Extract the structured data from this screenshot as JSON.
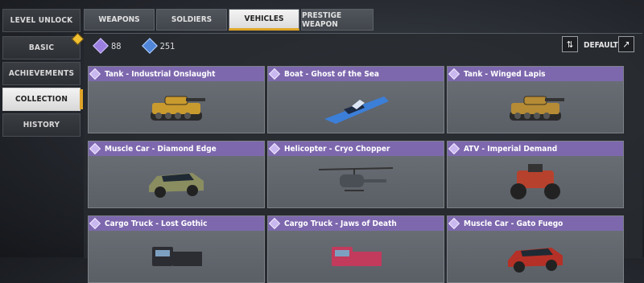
{
  "sidebar": {
    "items": [
      {
        "label": "LEVEL UNLOCK"
      },
      {
        "label": "BASIC"
      },
      {
        "label": "ACHIEVEMENTS"
      },
      {
        "label": "COLLECTION"
      },
      {
        "label": "HISTORY"
      }
    ],
    "active": "COLLECTION"
  },
  "tabs": [
    {
      "label": "WEAPONS"
    },
    {
      "label": "SOLDIERS"
    },
    {
      "label": "VEHICLES"
    },
    {
      "label": "PRESTIGE WEAPON"
    }
  ],
  "active_tab": "VEHICLES",
  "currency": [
    {
      "value": "88",
      "icon": "purple-diamond-icon",
      "color": "#9b7fe0"
    },
    {
      "value": "251",
      "icon": "blue-diamond-icon",
      "color": "#4f86d8"
    }
  ],
  "toolbar": {
    "sort_label": "DEFAULT"
  },
  "vehicles": [
    {
      "name": "Tank - Industrial Onslaught",
      "icon": "tank-icon",
      "color": "#c99a2e"
    },
    {
      "name": "Boat - Ghost of the Sea",
      "icon": "boat-icon",
      "color": "#3c7fd8"
    },
    {
      "name": "Tank - Winged Lapis",
      "icon": "tank-icon",
      "color": "#b58b35"
    },
    {
      "name": "Muscle Car - Diamond Edge",
      "icon": "car-icon",
      "color": "#8a8d60"
    },
    {
      "name": "Helicopter - Cryo Chopper",
      "icon": "helicopter-icon",
      "color": "#4a4f56"
    },
    {
      "name": "ATV - Imperial Demand",
      "icon": "atv-icon",
      "color": "#b6422e"
    },
    {
      "name": "Cargo Truck - Lost Gothic",
      "icon": "truck-icon",
      "color": "#2c2d33"
    },
    {
      "name": "Cargo Truck - Jaws of Death",
      "icon": "truck-icon",
      "color": "#c23a5c"
    },
    {
      "name": "Muscle Car - Gato Fuego",
      "icon": "car-icon",
      "color": "#b53026"
    }
  ]
}
